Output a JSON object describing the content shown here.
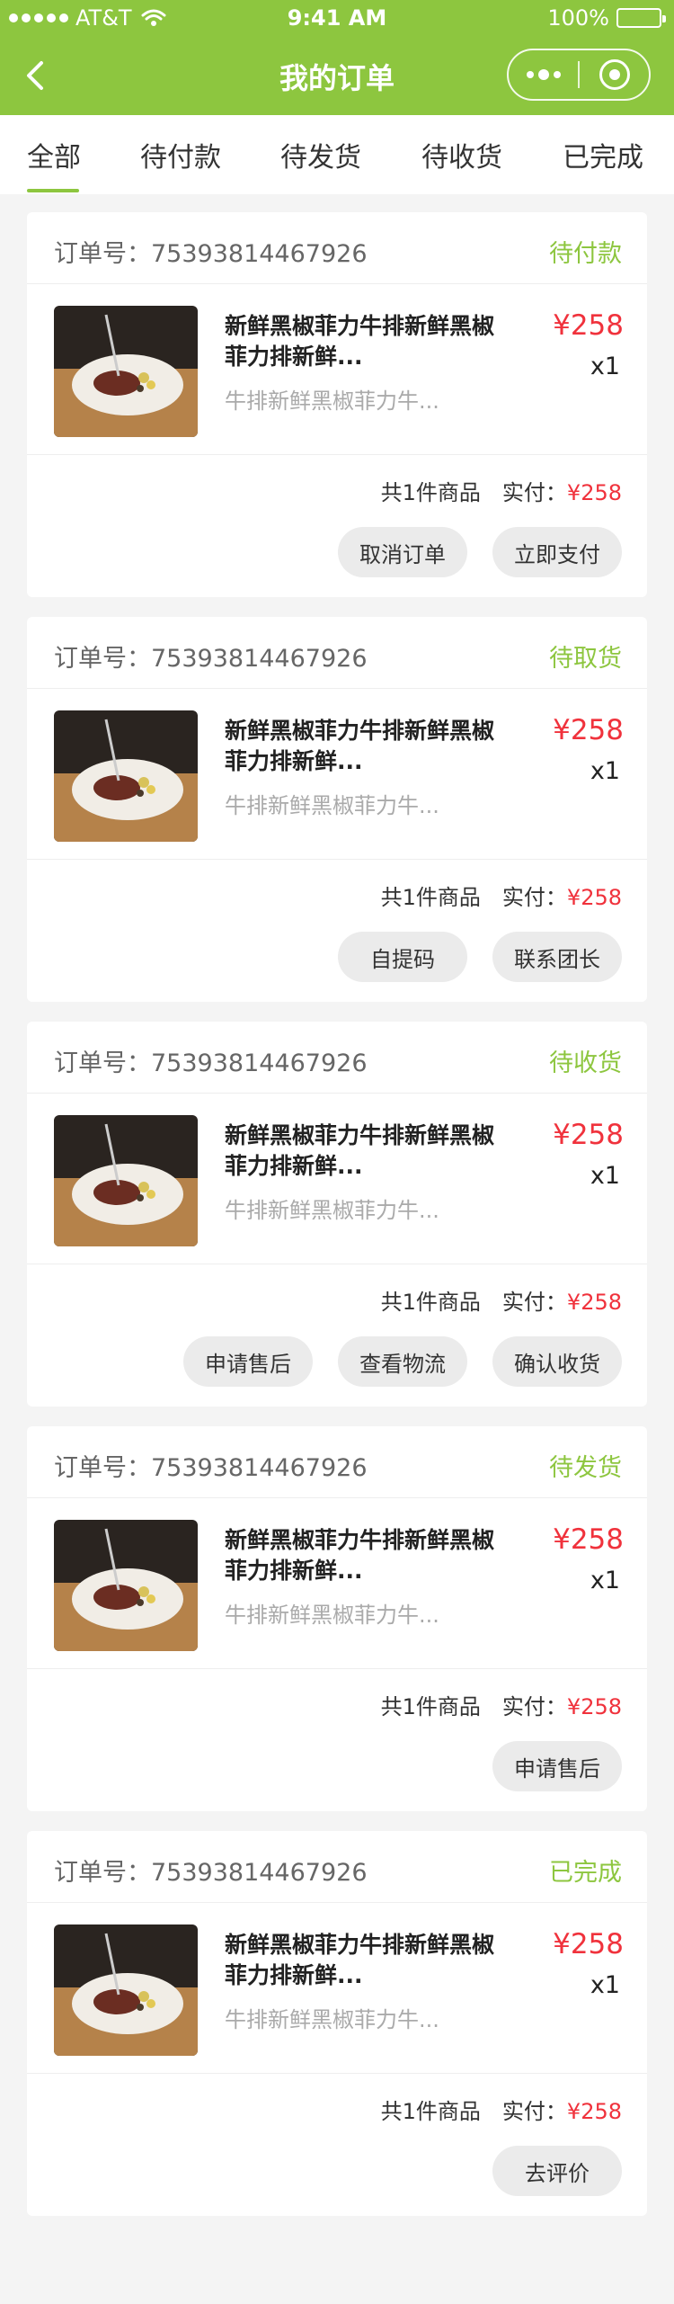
{
  "status_bar": {
    "carrier": "AT&T",
    "time": "9:41 AM",
    "battery": "100%",
    "battery_level": 1.0
  },
  "nav": {
    "title": "我的订单"
  },
  "tabs": [
    {
      "label": "全部",
      "active": true
    },
    {
      "label": "待付款",
      "active": false
    },
    {
      "label": "待发货",
      "active": false
    },
    {
      "label": "待收货",
      "active": false
    },
    {
      "label": "已完成",
      "active": false
    }
  ],
  "colors": {
    "accent": "#8dc63f",
    "price": "#f0323c"
  },
  "orders": [
    {
      "order_label": "订单号：75393814467926",
      "status": "待付款",
      "product_name": "新鲜黑椒菲力牛排新鲜黑椒菲力排新鲜...",
      "product_spec": "牛排新鲜黑椒菲力牛...",
      "price": "¥258",
      "qty": "x1",
      "count_text": "共1件商品",
      "paid_label": "实付：",
      "paid_value": "¥258",
      "actions": [
        "取消订单",
        "立即支付"
      ]
    },
    {
      "order_label": "订单号：75393814467926",
      "status": "待取货",
      "product_name": "新鲜黑椒菲力牛排新鲜黑椒菲力排新鲜...",
      "product_spec": "牛排新鲜黑椒菲力牛...",
      "price": "¥258",
      "qty": "x1",
      "count_text": "共1件商品",
      "paid_label": "实付：",
      "paid_value": "¥258",
      "actions": [
        "自提码",
        "联系团长"
      ]
    },
    {
      "order_label": "订单号：75393814467926",
      "status": "待收货",
      "product_name": "新鲜黑椒菲力牛排新鲜黑椒菲力排新鲜...",
      "product_spec": "牛排新鲜黑椒菲力牛...",
      "price": "¥258",
      "qty": "x1",
      "count_text": "共1件商品",
      "paid_label": "实付：",
      "paid_value": "¥258",
      "actions": [
        "申请售后",
        "查看物流",
        "确认收货"
      ]
    },
    {
      "order_label": "订单号：75393814467926",
      "status": "待发货",
      "product_name": "新鲜黑椒菲力牛排新鲜黑椒菲力排新鲜...",
      "product_spec": "牛排新鲜黑椒菲力牛...",
      "price": "¥258",
      "qty": "x1",
      "count_text": "共1件商品",
      "paid_label": "实付：",
      "paid_value": "¥258",
      "actions": [
        "申请售后"
      ]
    },
    {
      "order_label": "订单号：75393814467926",
      "status": "已完成",
      "product_name": "新鲜黑椒菲力牛排新鲜黑椒菲力排新鲜...",
      "product_spec": "牛排新鲜黑椒菲力牛...",
      "price": "¥258",
      "qty": "x1",
      "count_text": "共1件商品",
      "paid_label": "实付：",
      "paid_value": "¥258",
      "actions": [
        "去评价"
      ]
    }
  ]
}
